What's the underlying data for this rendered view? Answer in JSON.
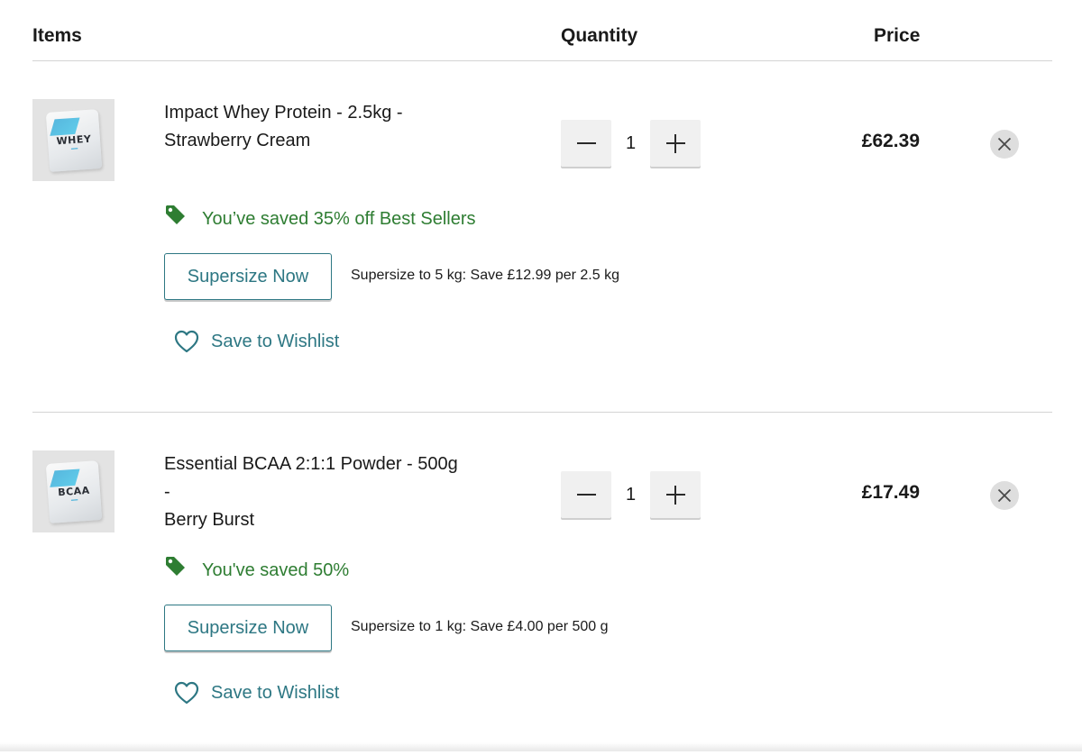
{
  "header": {
    "items_label": "Items",
    "quantity_label": "Quantity",
    "price_label": "Price"
  },
  "items": [
    {
      "name_line1": "Impact Whey Protein - 2.5kg -",
      "name_line2": "Strawberry Cream",
      "thumb_label": "WHEY",
      "thumb_icon": "protein-pouch-image",
      "quantity": "1",
      "price": "£62.39",
      "saving": "You’ve saved 35% off Best Sellers",
      "supersize_label": "Supersize Now",
      "supersize_note": "Supersize to 5 kg: Save £12.99 per 2.5 kg",
      "wishlist_label": "Save to Wishlist"
    },
    {
      "name_line1": "Essential BCAA 2:1:1 Powder - 500g -",
      "name_line2": "Berry Burst",
      "thumb_label": "BCAA",
      "thumb_icon": "bcaa-pouch-image",
      "quantity": "1",
      "price": "£17.49",
      "saving": "You've saved 50%",
      "supersize_label": "Supersize Now",
      "supersize_note": "Supersize to 1 kg: Save £4.00 per 500 g",
      "wishlist_label": "Save to Wishlist"
    }
  ],
  "colors": {
    "saving_green": "#2e7d32",
    "accent_teal": "#2d7783",
    "divider": "#d4d4d4"
  },
  "icons": [
    "minus-icon",
    "plus-icon",
    "close-icon",
    "price-tag-icon",
    "heart-icon"
  ]
}
